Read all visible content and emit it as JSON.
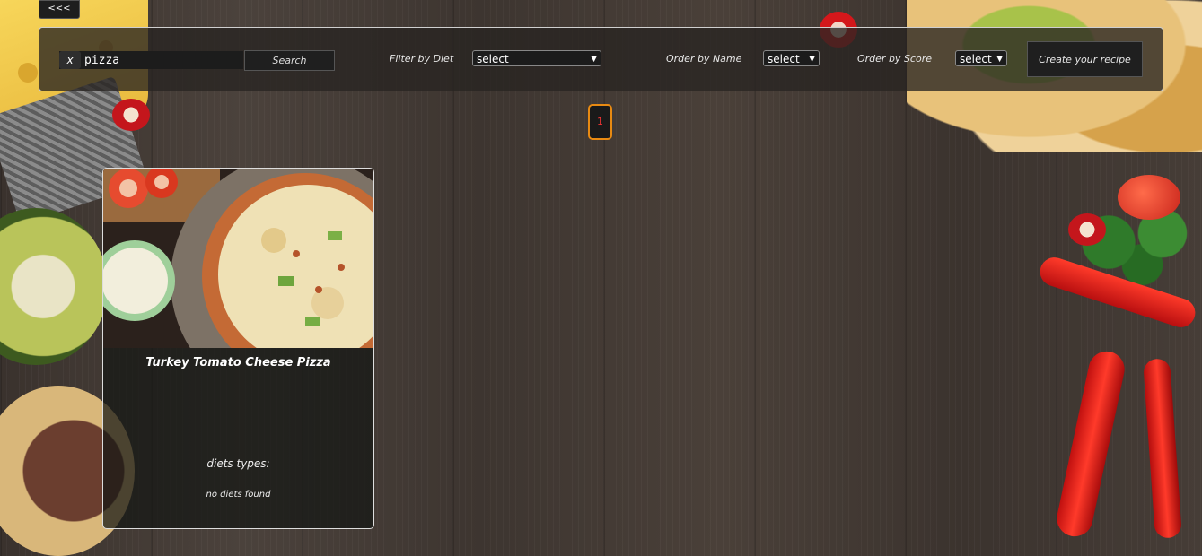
{
  "nav": {
    "back_label": "<<<"
  },
  "search": {
    "clear_label": "x",
    "value": "pizza",
    "button_label": "Search"
  },
  "filters": {
    "diet": {
      "label": "Filter by Diet",
      "selected": "select"
    },
    "name": {
      "label": "Order by Name",
      "selected": "select"
    },
    "score": {
      "label": "Order by Score",
      "selected": "select"
    }
  },
  "create_button_label": "Create your recipe",
  "pagination": {
    "pages": [
      "1"
    ]
  },
  "cards": [
    {
      "title": "Turkey Tomato Cheese Pizza",
      "diets_label": "diets types:",
      "diets_value": "no diets found"
    }
  ]
}
